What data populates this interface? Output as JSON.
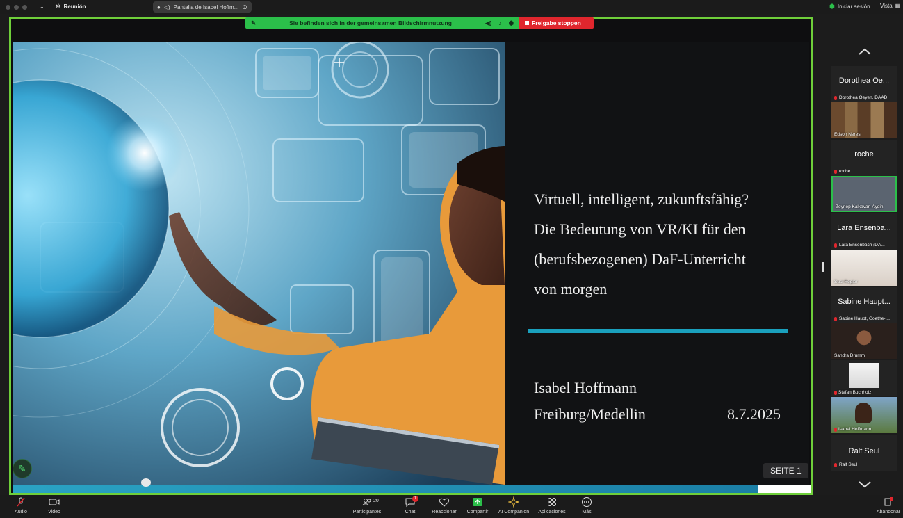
{
  "topbar": {
    "meeting_label": "Reunión",
    "tab_label": "Pantalla de Isabel Hoffm...",
    "signin_label": "Iniciar sesión",
    "view_label": "Vista"
  },
  "share_banner": {
    "message": "Sie befinden sich in der gemeinsamen Bildschirmnutzung",
    "stop_label": "Freigabe stoppen"
  },
  "slide": {
    "title_lines": [
      "Virtuell, intelligent, zukunftsfähig?",
      "Die Bedeutung von VR/KI für den",
      "(berufsbezogenen) DaF-Unterricht",
      "von morgen"
    ],
    "presenter": "Isabel Hoffmann",
    "location": "Freiburg/Medellin",
    "date": "8.7.2025",
    "page_label": "SEITE 1"
  },
  "participants": {
    "tiles": [
      {
        "name": "Dorothea Oe...",
        "subtitle": "Dorothea Oeyen, DAAD",
        "video_label": "Edson Neres"
      },
      {
        "name": "roche",
        "subtitle": "roche",
        "video_label": "Zeynep Kalkavan-Aydin"
      },
      {
        "name": "Lara Ensenba...",
        "subtitle": "Lara Ensenbach (DA...",
        "video_label": "Susi Regler"
      },
      {
        "name": "Sabine Haupt...",
        "subtitle": "Sabine Haupt, Goethe-I...",
        "video_label": "Sandra Drumm"
      }
    ],
    "extra_tiles": [
      {
        "video_label": "Stefan Buchholz"
      },
      {
        "video_label": "Isabel Hoffmann"
      }
    ],
    "last_tile": {
      "name": "Ralf Seul",
      "subtitle": "Ralf Seul"
    }
  },
  "toolbar": {
    "audio": "Audio",
    "video": "Video",
    "participants": "Participantes",
    "participants_count": "20",
    "chat": "Chat",
    "chat_badge": "1",
    "react": "Reaccionar",
    "share": "Compartir",
    "ai": "AI Companion",
    "apps": "Aplicaciones",
    "more": "Más",
    "leave": "Abandonar"
  }
}
